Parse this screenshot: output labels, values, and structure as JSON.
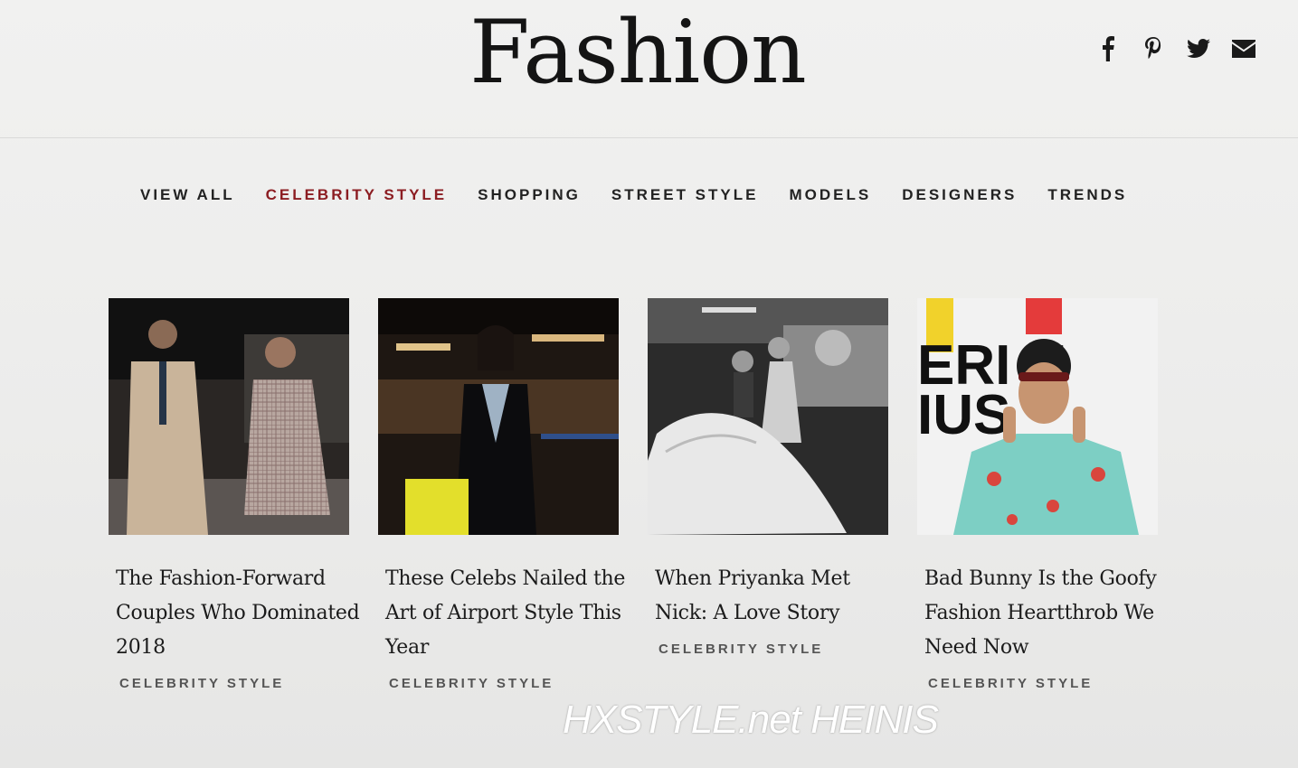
{
  "header": {
    "title": "Fashion",
    "social_icons": [
      "facebook-icon",
      "pinterest-icon",
      "twitter-icon",
      "email-icon"
    ]
  },
  "nav": {
    "items": [
      {
        "label": "VIEW ALL"
      },
      {
        "label": "CELEBRITY STYLE",
        "active": true
      },
      {
        "label": "SHOPPING"
      },
      {
        "label": "STREET STYLE"
      },
      {
        "label": "MODELS"
      },
      {
        "label": "DESIGNERS"
      },
      {
        "label": "TRENDS"
      }
    ]
  },
  "articles": [
    {
      "title": "The Fashion-Forward Couples Who Dominated 2018",
      "category": "CELEBRITY STYLE"
    },
    {
      "title": "These Celebs Nailed the Art of Airport Style This Year",
      "category": "CELEBRITY STYLE"
    },
    {
      "title": "When Priyanka Met Nick: A Love Story",
      "category": "CELEBRITY STYLE"
    },
    {
      "title": "Bad Bunny Is the Goofy Fashion Heartthrob We Need Now",
      "category": "CELEBRITY STYLE"
    }
  ],
  "watermark": "HXSTYLE.net HEINIS",
  "colors": {
    "active_nav": "#8c1d22",
    "text": "#1a1a1a",
    "category": "#555555"
  }
}
